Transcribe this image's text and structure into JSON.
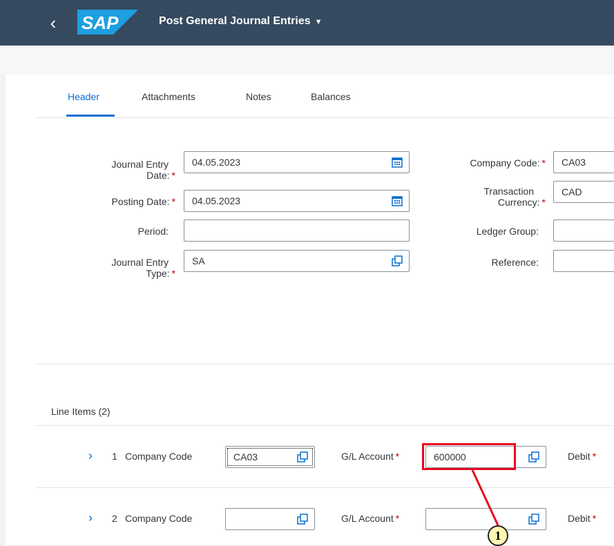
{
  "shell": {
    "back_icon": "chevron-left-icon",
    "logo_text": "SAP",
    "title": "Post General Journal Entries",
    "title_caret": "▼",
    "colors": {
      "shell": "#354a5f",
      "brand": "#0a6ed1",
      "required": "#bb0000",
      "highlight": "#e8081e"
    }
  },
  "tabs": [
    {
      "label": "Header",
      "active": true
    },
    {
      "label": "Attachments",
      "active": false
    },
    {
      "label": "Notes",
      "active": false
    },
    {
      "label": "Balances",
      "active": false
    }
  ],
  "header": {
    "journal_entry_date": {
      "label_line1": "Journal Entry",
      "label_line2": "Date:",
      "required": "*",
      "value": "04.05.2023",
      "icon": "calendar-icon"
    },
    "posting_date": {
      "label": "Posting Date:",
      "required": "*",
      "value": "04.05.2023",
      "icon": "calendar-icon"
    },
    "period": {
      "label": "Period:",
      "value": ""
    },
    "journal_entry_type": {
      "label_line1": "Journal Entry",
      "label_line2": "Type:",
      "required": "*",
      "value": "SA",
      "icon": "value-help-icon"
    },
    "company_code": {
      "label": "Company Code:",
      "required": "*",
      "value": "CA03"
    },
    "transaction_currency": {
      "label_line1": "Transaction",
      "label_line2": "Currency:",
      "required": "*",
      "value": "CAD"
    },
    "ledger_group": {
      "label": "Ledger Group:",
      "value": ""
    },
    "reference": {
      "label": "Reference:",
      "value": ""
    }
  },
  "line_items": {
    "title": "Line Items (2)",
    "rows": [
      {
        "index": "1",
        "company_code_label": "Company Code",
        "company_code": "CA03",
        "gl_label": "G/L Account",
        "required": "*",
        "gl_account": "600000",
        "debit_label": "Debit",
        "debit_required": "*"
      },
      {
        "index": "2",
        "company_code_label": "Company Code",
        "company_code": "",
        "gl_label": "G/L Account",
        "required": "*",
        "gl_account": "",
        "debit_label": "Debit",
        "debit_required": "*"
      }
    ]
  },
  "annotation": {
    "callout_number": "1"
  }
}
